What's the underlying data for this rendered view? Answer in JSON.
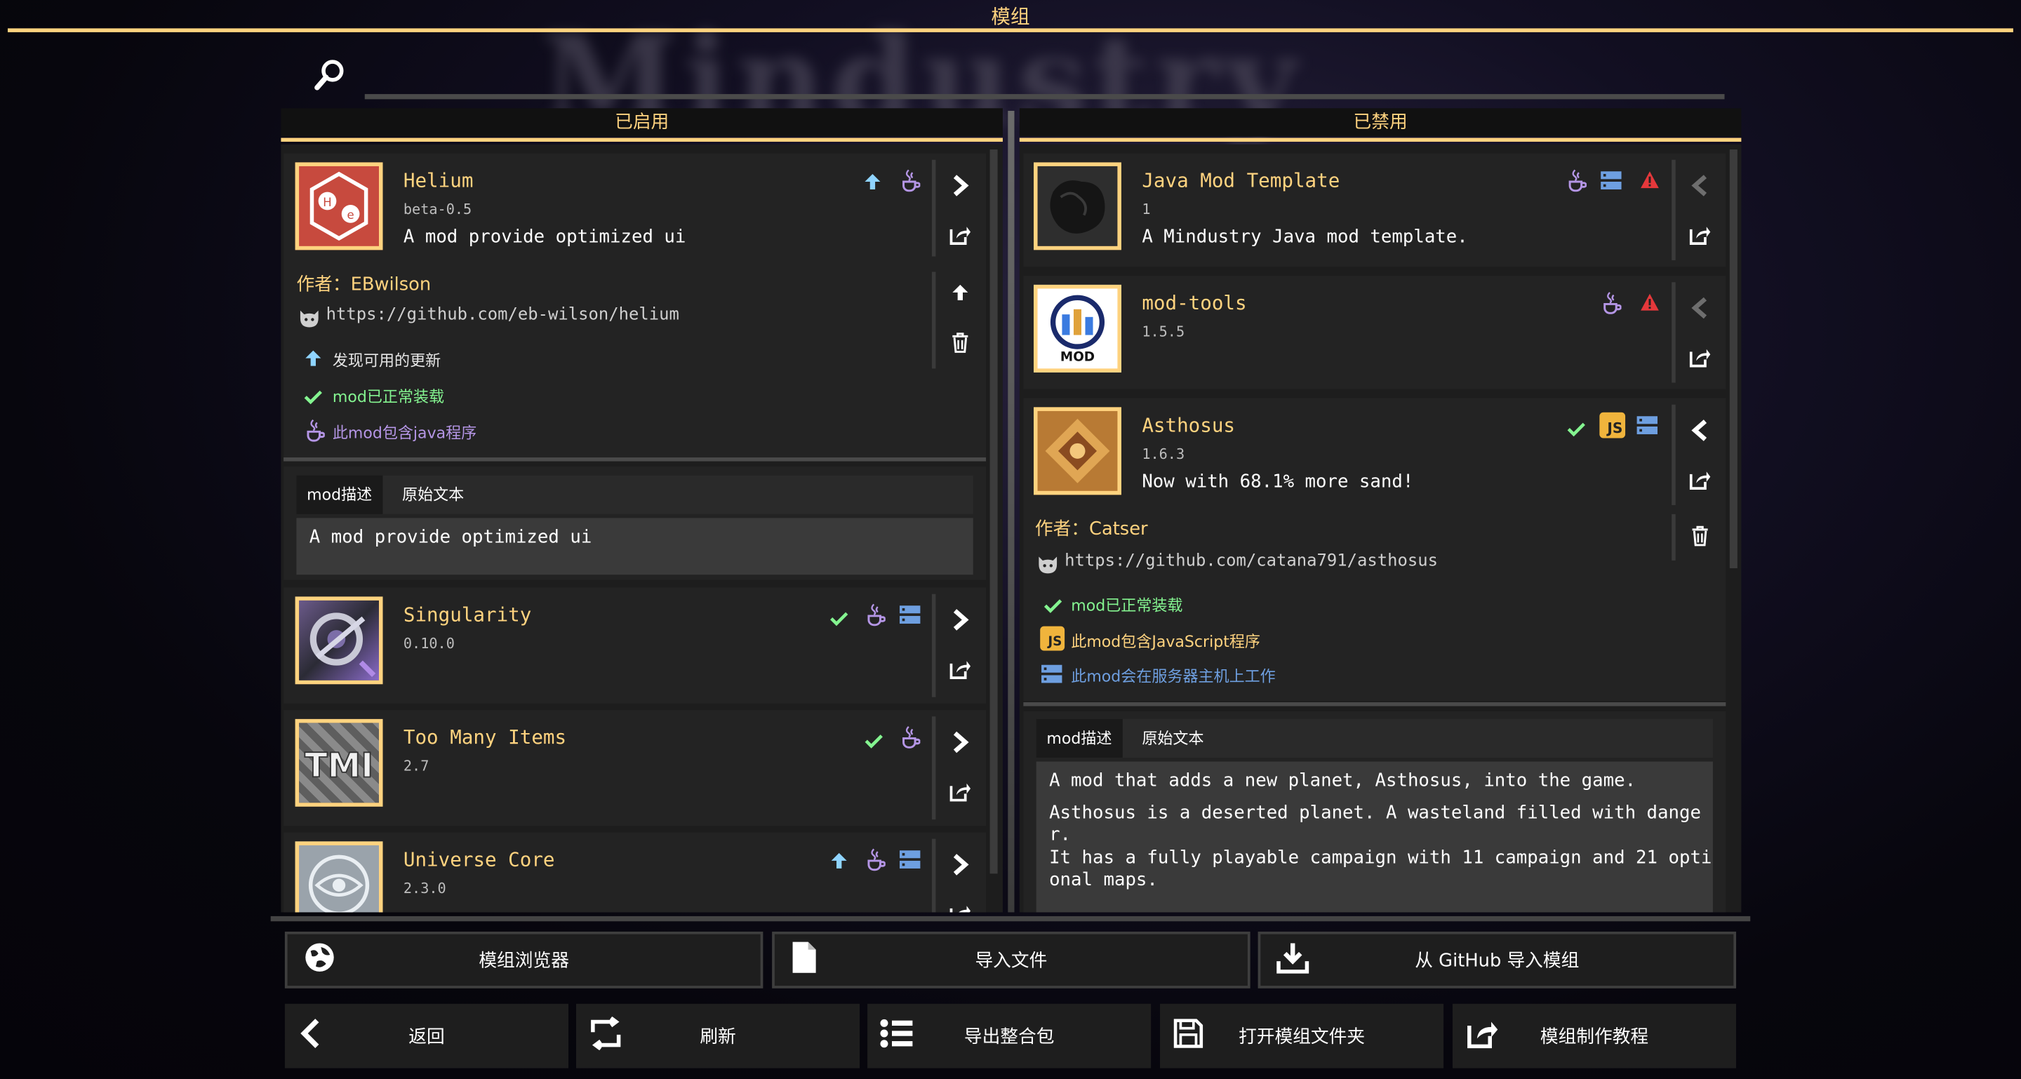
{
  "window_title": "模组",
  "background_title": "Mindustry",
  "columns": {
    "enabled": "已启用",
    "disabled": "已禁用"
  },
  "enabled_mods": [
    {
      "name": "Helium",
      "version": "beta-0.5",
      "description": "A mod provide optimized ui",
      "thumb": "helium-logo"
    },
    {
      "name": "Singularity",
      "version": "0.10.0",
      "thumb": "singularity-logo"
    },
    {
      "name": "Too Many Items",
      "version": "2.7",
      "thumb": "tmi-logo"
    },
    {
      "name": "Universe Core",
      "version": "2.3.0",
      "thumb": "universe-logo"
    }
  ],
  "helium_details": {
    "author_label": "作者：",
    "author": "EBwilson",
    "repo": "https://github.com/eb-wilson/helium",
    "status_update": "发现可用的更新",
    "status_loaded": "mod已正常装载",
    "status_java": "此mod包含java程序",
    "tab_desc": "mod描述",
    "tab_raw": "原始文本",
    "desc_text": "A mod provide optimized ui"
  },
  "disabled_mods": [
    {
      "name": "Java Mod Template",
      "version": "1",
      "description": "A Mindustry Java mod template.",
      "thumb": "template-logo"
    },
    {
      "name": "mod-tools",
      "version": "1.5.5",
      "thumb": "mod-tools-logo"
    },
    {
      "name": "Asthosus",
      "version": "1.6.3",
      "description": "Now with 68.1% more sand!",
      "thumb": "asthosus-logo"
    }
  ],
  "asthosus_details": {
    "author_label": "作者：",
    "author": "Catser",
    "repo": "https://github.com/catana791/asthosus",
    "status_loaded": "mod已正常装载",
    "status_js": "此mod包含JavaScript程序",
    "status_server": "此mod会在服务器主机上工作",
    "tab_desc": "mod描述",
    "tab_raw": "原始文本",
    "desc_line1": "A mod that adds a new planet, Asthosus, into the game.",
    "desc_line2": "Asthosus is a deserted planet. A wasteland filled with dange",
    "desc_line3": "r.",
    "desc_line4": "It has a fully playable campaign with 11 campaign and 21 opti",
    "desc_line5": "onal maps."
  },
  "buttons_row1": {
    "browser": "模组浏览器",
    "import_file": "导入文件",
    "import_github": "从 GitHub 导入模组"
  },
  "buttons_row2": {
    "back": "返回",
    "refresh": "刷新",
    "export_pack": "导出整合包",
    "open_folder": "打开模组文件夹",
    "tutorial": "模组制作教程"
  },
  "js_badge": "JS",
  "mod_badge": "MOD",
  "colors": {
    "accent": "#ffd37f",
    "update": "#8fd4ff",
    "ok": "#84f490",
    "java": "#b596e6",
    "server": "#6e9fe0",
    "warn": "#e5383b"
  }
}
